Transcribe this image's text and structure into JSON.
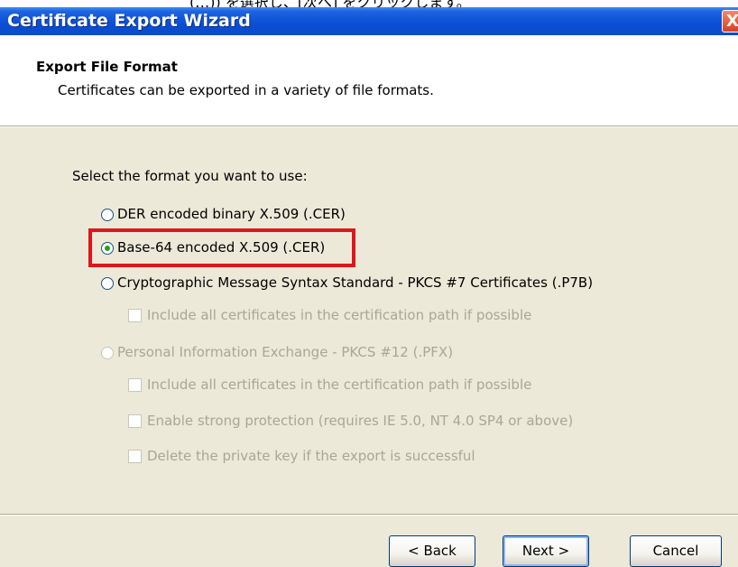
{
  "top_strip": {
    "text": "(…)) を選択し、[次へ] をクリックします。"
  },
  "window": {
    "title": "Certificate Export Wizard",
    "close_glyph": "X"
  },
  "header": {
    "title": "Export File Format",
    "subtitle": "Certificates can be exported in a variety of file formats."
  },
  "prompt": "Select the format you want to use:",
  "options": {
    "der": {
      "label": "DER encoded binary X.509 (.CER)",
      "selected": false,
      "enabled": true
    },
    "base64": {
      "label": "Base-64 encoded X.509 (.CER)",
      "selected": true,
      "enabled": true
    },
    "pkcs7": {
      "label": "Cryptographic Message Syntax Standard - PKCS #7 Certificates (.P7B)",
      "selected": false,
      "enabled": true
    },
    "pkcs7_include_all": {
      "label": "Include all certificates in the certification path if possible",
      "checked": false,
      "enabled": false
    },
    "pfx": {
      "label": "Personal Information Exchange - PKCS #12 (.PFX)",
      "selected": false,
      "enabled": false
    },
    "pfx_include_all": {
      "label": "Include all certificates in the certification path if possible",
      "checked": false,
      "enabled": false
    },
    "pfx_strong_protection": {
      "label": "Enable strong protection (requires IE 5.0, NT 4.0 SP4 or above)",
      "checked": false,
      "enabled": false
    },
    "pfx_delete_key": {
      "label": "Delete the private key if the export is successful",
      "checked": false,
      "enabled": false
    }
  },
  "buttons": {
    "back": "< Back",
    "next": "Next >",
    "cancel": "Cancel"
  },
  "colors": {
    "title_bar": "#0a4ed4",
    "highlight": "#e0161b",
    "dialog_bg": "#ece9d8",
    "radio_selected": "#21a121"
  }
}
